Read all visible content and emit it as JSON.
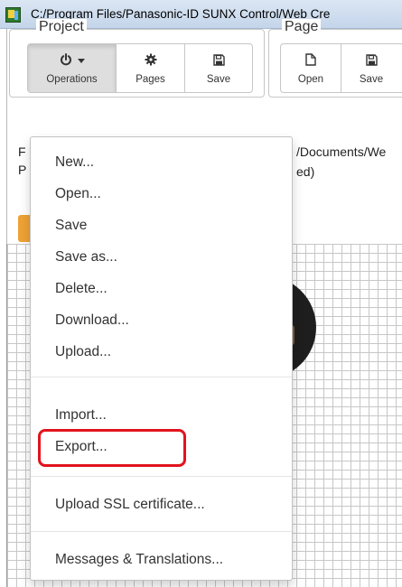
{
  "window": {
    "title": "C:/Program Files/Panasonic-ID SUNX Control/Web Cre"
  },
  "project_group": {
    "legend": "Project",
    "buttons": [
      {
        "label": "Operations",
        "icon": "power-icon"
      },
      {
        "label": "Pages",
        "icon": "gear-icon"
      },
      {
        "label": "Save",
        "icon": "floppy-icon"
      }
    ]
  },
  "page_group": {
    "legend": "Page",
    "buttons": [
      {
        "label": "Open",
        "icon": "file-icon"
      },
      {
        "label": "Save",
        "icon": "floppy-icon"
      }
    ]
  },
  "info": {
    "line1_prefix": "F",
    "line1_path": "/Documents/We",
    "line2_prefix": "P",
    "line2_text": "ed)"
  },
  "menu": {
    "items": [
      "New...",
      "Open...",
      "Save",
      "Save as...",
      "Delete...",
      "Download...",
      "Upload...",
      "Import...",
      "Export...",
      "Upload SSL certificate...",
      "Messages & Translations..."
    ],
    "highlighted": "Export..."
  },
  "colors": {
    "highlight_border": "#e1141d",
    "accent_orange": "#eea236",
    "grid_line": "#c7c7c7"
  }
}
